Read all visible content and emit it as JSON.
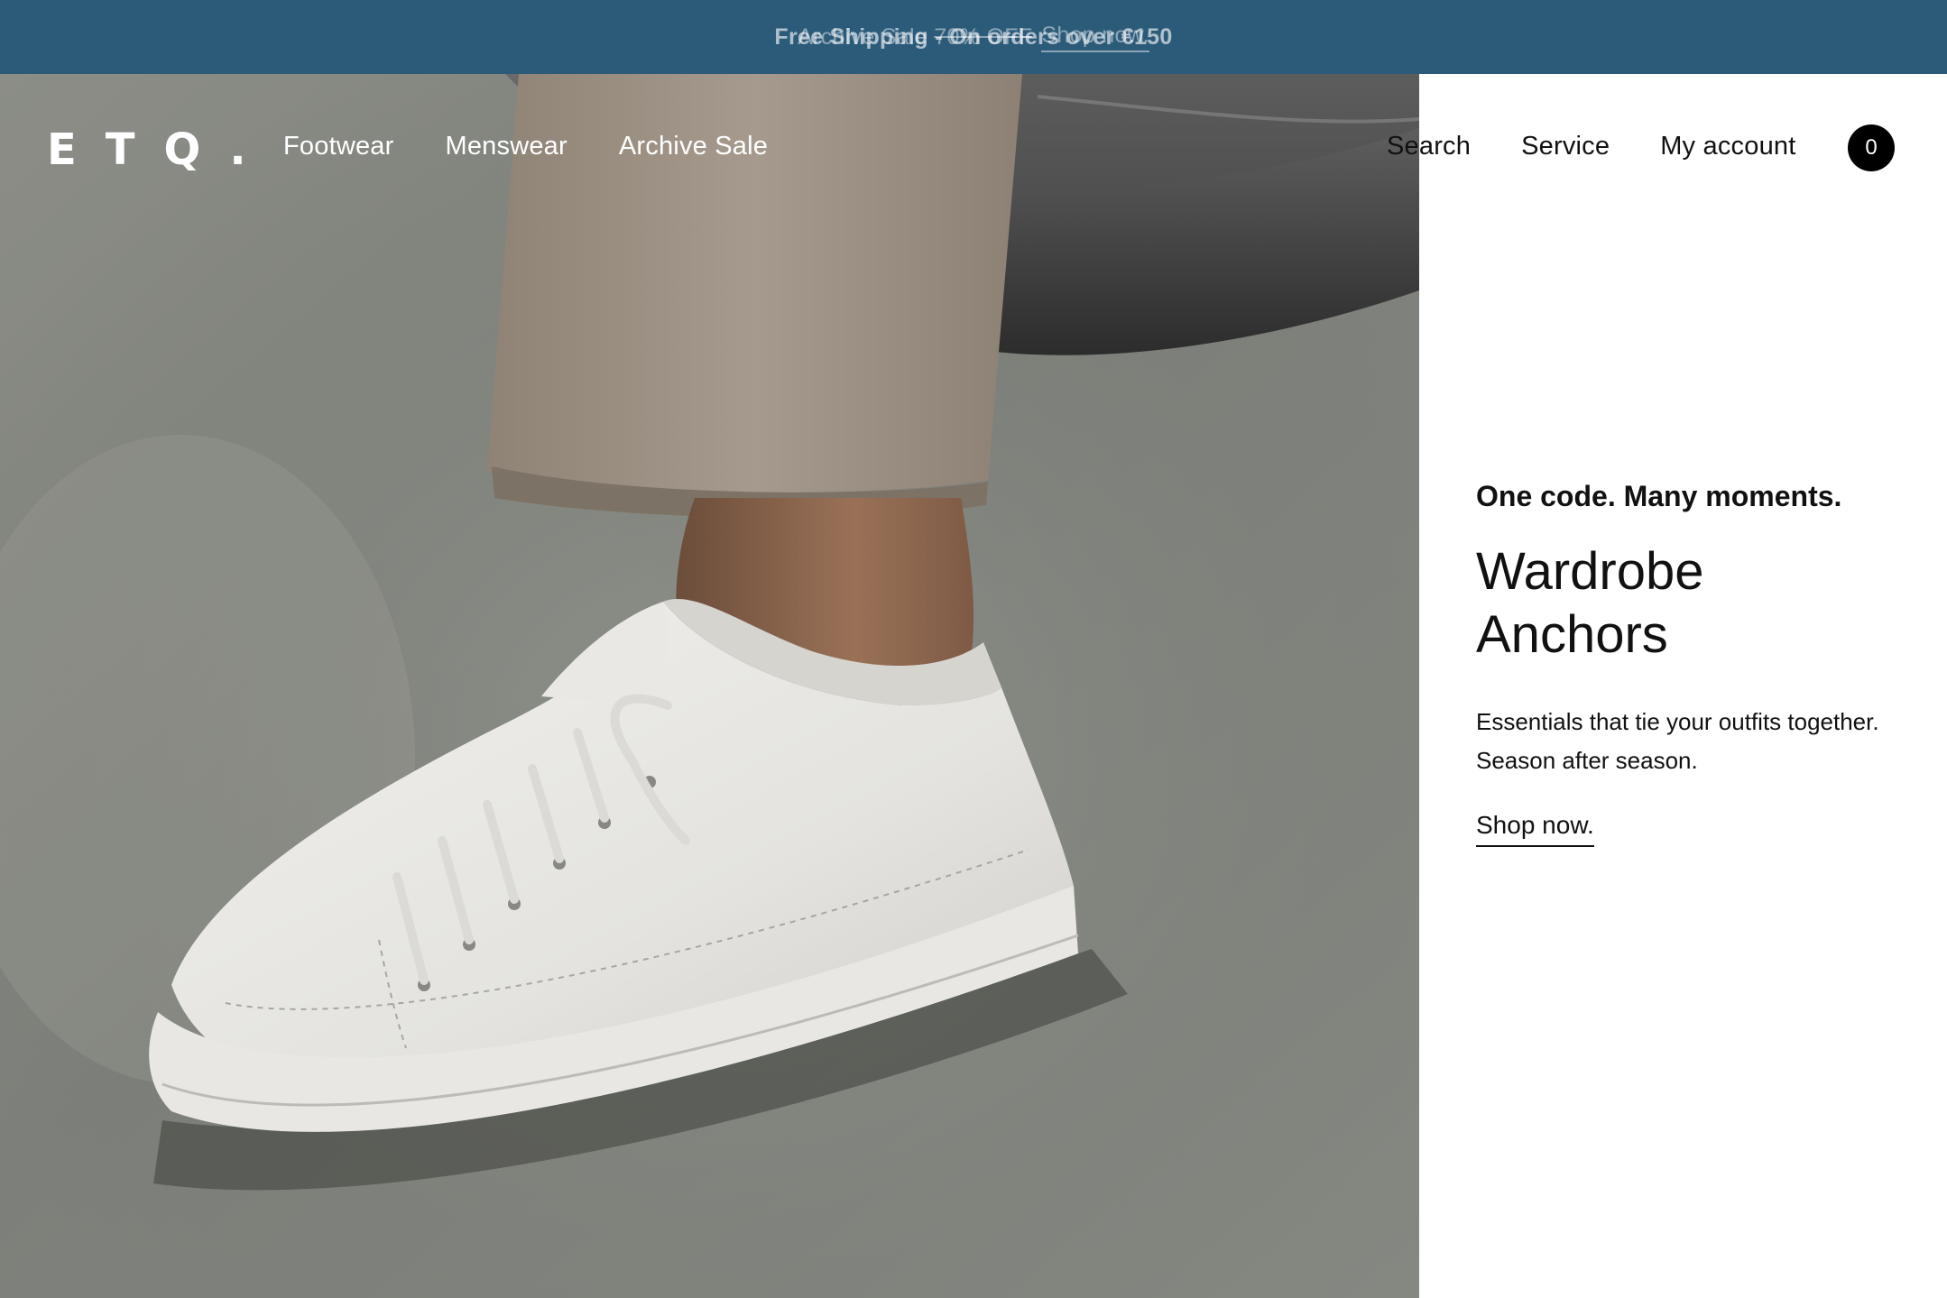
{
  "announcement": {
    "faded_message": {
      "prefix": "Archive Sale",
      "strike_text": "70% OFF",
      "link_label": "Shop now."
    },
    "active_message": "Free Shipping - On orders over €150"
  },
  "header": {
    "logo": "ETQ.",
    "nav_left": [
      "Footwear",
      "Menswear",
      "Archive Sale"
    ],
    "nav_right": [
      "Search",
      "Service",
      "My account"
    ],
    "cart_count": "0"
  },
  "promo": {
    "eyebrow": "One code. Many moments.",
    "title": "Wardrobe Anchors",
    "description": "Essentials that tie your outfits together. Season after season.",
    "cta": "Shop now."
  },
  "colors": {
    "announcement_bg": "#2c5b7a",
    "panel_bg": "#ffffff",
    "text": "#111111",
    "cart_badge": "#000000"
  }
}
